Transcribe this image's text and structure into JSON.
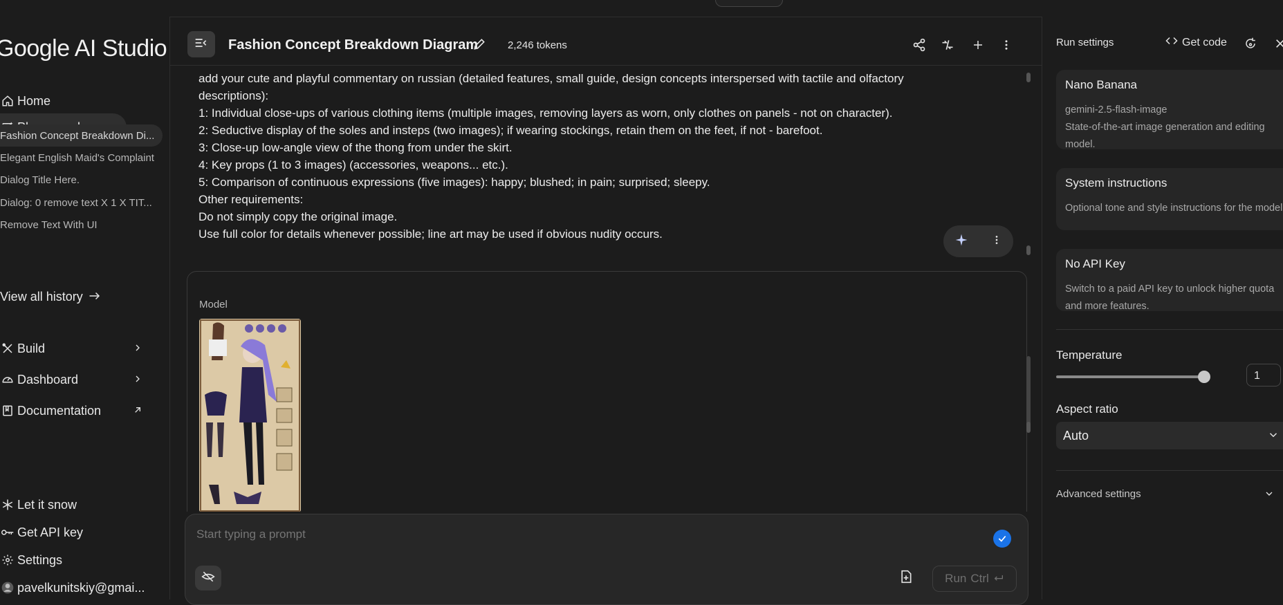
{
  "app": {
    "logo_text": "Google AI Studio"
  },
  "sidebar": {
    "home": "Home",
    "playground": "Playground",
    "history": [
      "Fashion Concept Breakdown Di...",
      "Elegant English Maid's Complaint",
      "Dialog Title Here.",
      "Dialog: 0 remove text X 1 X TIT...",
      "Remove Text With UI"
    ],
    "view_all": "View all history",
    "build": "Build",
    "dashboard": "Dashboard",
    "documentation": "Documentation",
    "let_it_snow": "Let it snow",
    "get_api_key": "Get API key",
    "settings": "Settings",
    "account": "pavelkunitskiy@gmai..."
  },
  "header": {
    "title": "Fashion Concept Breakdown Diagram",
    "tokens": "2,246 tokens"
  },
  "chat": {
    "prompt_lines": [
      "add your cute and playful commentary on russian (detailed features, small guide, design concepts interspersed with tactile and olfactory",
      "descriptions):",
      "1: Individual close-ups of various clothing items (multiple images, removing layers as worn, only clothes on panels - not on character).",
      "2: Seductive display of the soles and insteps (two images); if wearing stockings, retain them on the feet, if not - barefoot.",
      "3: Close-up low-angle view of the thong from under the skirt.",
      "4: Key props (1 to 3 images) (accessories, weapons... etc.).",
      "5: Comparison of continuous expressions (five images): happy; blushed; in pain; surprised; sleepy.",
      "Other requirements:",
      "Do not simply copy the original image.",
      "Use full color for details whenever possible; line art may be used if obvious nudity occurs."
    ],
    "model_label": "Model"
  },
  "input": {
    "placeholder": "Start typing a prompt",
    "run_label": "Run",
    "run_shortcut": "Ctrl"
  },
  "right_panel": {
    "title": "Run settings",
    "get_code": "Get code",
    "model": {
      "name": "Nano Banana",
      "id": "gemini-2.5-flash-image",
      "description": "State-of-the-art image generation and editing model."
    },
    "system_instructions": {
      "title": "System instructions",
      "description": "Optional tone and style instructions for the model"
    },
    "api_key": {
      "title": "No API Key",
      "description": "Switch to a paid API key to unlock higher quota and more features."
    },
    "temperature": {
      "label": "Temperature",
      "value": "1"
    },
    "aspect_ratio": {
      "label": "Aspect ratio",
      "value": "Auto"
    },
    "advanced": "Advanced settings"
  },
  "colors": {
    "accent": "#1a73e8",
    "background": "#1c1c1c",
    "surface": "#262626"
  }
}
